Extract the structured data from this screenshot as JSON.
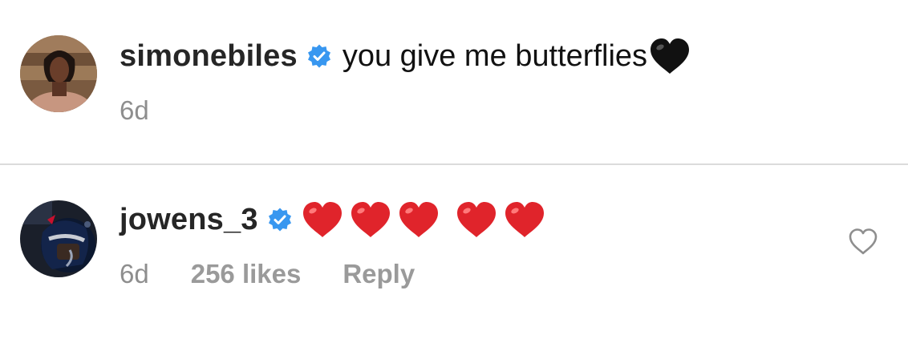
{
  "comments": [
    {
      "username": "simonebiles",
      "verified": true,
      "text": "you give me butterflies",
      "emoji": [
        "black-heart"
      ],
      "time": "6d"
    },
    {
      "username": "jowens_3",
      "verified": true,
      "text": "",
      "emoji": [
        "red-heart",
        "red-heart",
        "red-heart",
        "red-heart",
        "red-heart"
      ],
      "time": "6d",
      "likes": "256 likes",
      "reply": "Reply"
    }
  ],
  "colors": {
    "verified": "#3897f0",
    "meta": "#8e8e8e",
    "username": "#262626",
    "red_heart": "#e0242b",
    "black_heart": "#111111",
    "divider": "#dbdbdb"
  },
  "icons": [
    "verified-badge-icon",
    "black-heart-emoji",
    "red-heart-emoji",
    "like-heart-outline-icon"
  ]
}
